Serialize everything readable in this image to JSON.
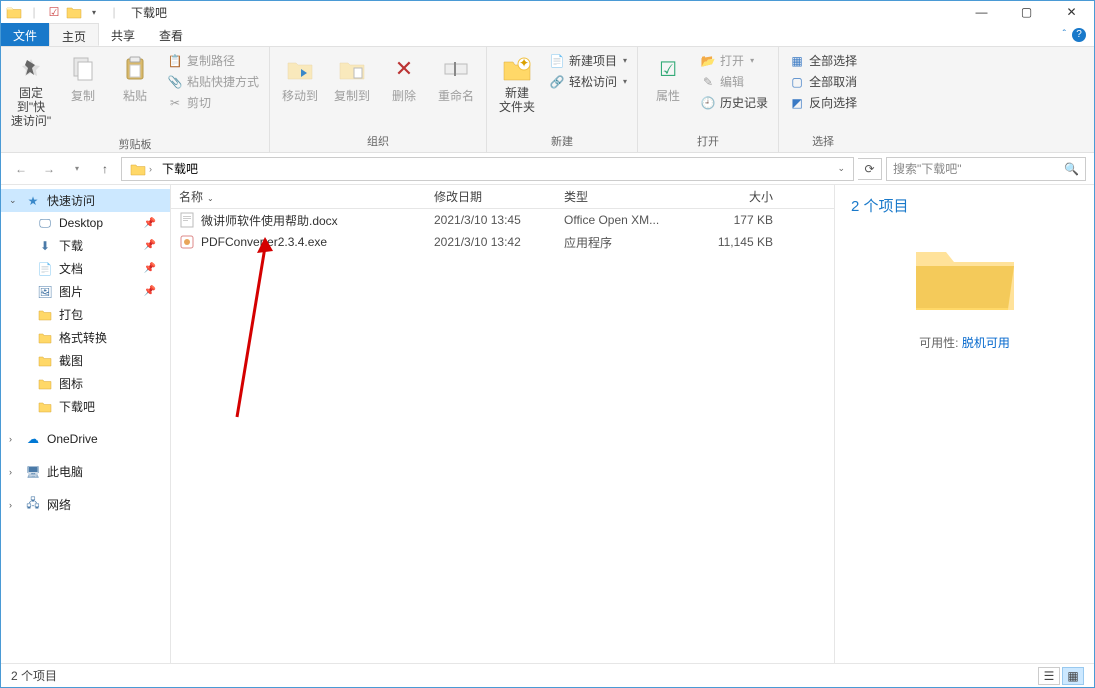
{
  "window": {
    "title": "下载吧",
    "qat_sep": "|"
  },
  "tabs": {
    "file": "文件",
    "home": "主页",
    "share": "共享",
    "view": "查看"
  },
  "ribbon": {
    "clipboard": {
      "pin": "固定到\"快\n速访问\"",
      "copy": "复制",
      "paste": "粘贴",
      "copy_path": "复制路径",
      "paste_shortcut": "粘贴快捷方式",
      "cut": "剪切",
      "label": "剪贴板"
    },
    "organize": {
      "move_to": "移动到",
      "copy_to": "复制到",
      "delete": "删除",
      "rename": "重命名",
      "label": "组织"
    },
    "new_": {
      "new_folder": "新建\n文件夹",
      "new_item": "新建项目",
      "easy_access": "轻松访问",
      "label": "新建"
    },
    "open": {
      "properties": "属性",
      "open": "打开",
      "edit": "编辑",
      "history": "历史记录",
      "label": "打开"
    },
    "select": {
      "select_all": "全部选择",
      "select_none": "全部取消",
      "invert": "反向选择",
      "label": "选择"
    }
  },
  "addr": {
    "root": "下载吧",
    "search_placeholder": "搜索\"下载吧\""
  },
  "sidebar": {
    "quick": "快速访问",
    "items": [
      {
        "label": "Desktop"
      },
      {
        "label": "下载"
      },
      {
        "label": "文档"
      },
      {
        "label": "图片"
      },
      {
        "label": "打包"
      },
      {
        "label": "格式转换"
      },
      {
        "label": "截图"
      },
      {
        "label": "图标"
      },
      {
        "label": "下载吧"
      }
    ],
    "onedrive": "OneDrive",
    "this_pc": "此电脑",
    "network": "网络"
  },
  "columns": {
    "name": "名称",
    "date": "修改日期",
    "type": "类型",
    "size": "大小"
  },
  "files": [
    {
      "name": "微讲师软件使用帮助.docx",
      "date": "2021/3/10 13:45",
      "type": "Office Open XM...",
      "size": "177 KB",
      "icon": "docx"
    },
    {
      "name": "PDFConverter2.3.4.exe",
      "date": "2021/3/10 13:42",
      "type": "应用程序",
      "size": "11,145 KB",
      "icon": "exe"
    }
  ],
  "details": {
    "count": "2 个项目",
    "avail_label": "可用性:",
    "avail_value": "脱机可用"
  },
  "status": {
    "text": "2 个项目"
  }
}
